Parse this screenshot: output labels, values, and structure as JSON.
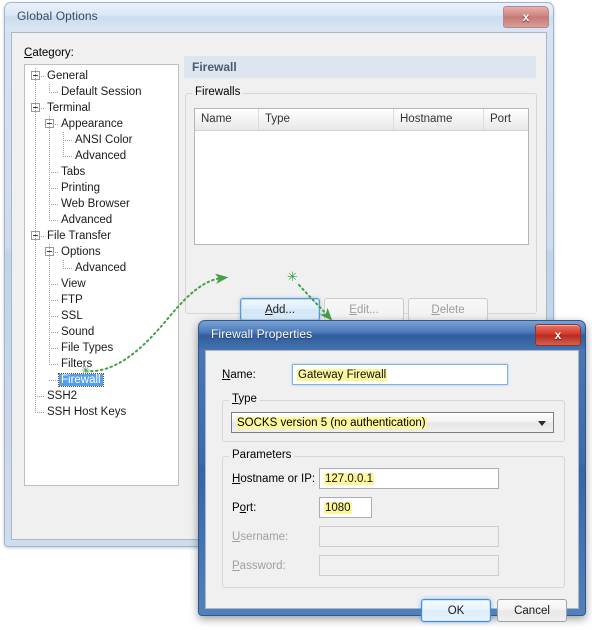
{
  "main_window": {
    "title": "Global Options",
    "close_label": "x",
    "category_label": "Category:",
    "tree": [
      {
        "label": "General",
        "depth": 0,
        "expander": "minus"
      },
      {
        "label": "Default Session",
        "depth": 1,
        "expander": "none"
      },
      {
        "label": "Terminal",
        "depth": 0,
        "expander": "minus"
      },
      {
        "label": "Appearance",
        "depth": 1,
        "expander": "minus"
      },
      {
        "label": "ANSI Color",
        "depth": 2,
        "expander": "none"
      },
      {
        "label": "Advanced",
        "depth": 2,
        "expander": "none"
      },
      {
        "label": "Tabs",
        "depth": 1,
        "expander": "none"
      },
      {
        "label": "Printing",
        "depth": 1,
        "expander": "none"
      },
      {
        "label": "Web Browser",
        "depth": 1,
        "expander": "none"
      },
      {
        "label": "Advanced",
        "depth": 1,
        "expander": "none"
      },
      {
        "label": "File Transfer",
        "depth": 0,
        "expander": "minus"
      },
      {
        "label": "Options",
        "depth": 1,
        "expander": "minus"
      },
      {
        "label": "Advanced",
        "depth": 2,
        "expander": "none"
      },
      {
        "label": "View",
        "depth": 1,
        "expander": "none"
      },
      {
        "label": "FTP",
        "depth": 1,
        "expander": "none"
      },
      {
        "label": "SSL",
        "depth": 1,
        "expander": "none"
      },
      {
        "label": "Sound",
        "depth": 1,
        "expander": "none"
      },
      {
        "label": "File Types",
        "depth": 1,
        "expander": "none"
      },
      {
        "label": "Filters",
        "depth": 1,
        "expander": "none"
      },
      {
        "label": "Firewall",
        "depth": 1,
        "expander": "none",
        "selected": true
      },
      {
        "label": "SSH2",
        "depth": 0,
        "expander": "none"
      },
      {
        "label": "SSH Host Keys",
        "depth": 0,
        "expander": "none"
      }
    ],
    "page_header": "Firewall",
    "firewalls_group": "Firewalls",
    "table": {
      "columns": [
        "Name",
        "Type",
        "Hostname",
        "Port"
      ],
      "rows": []
    },
    "buttons": {
      "add": "Add...",
      "edit": "Edit...",
      "delete": "Delete"
    }
  },
  "dialog": {
    "title": "Firewall Properties",
    "close_label": "x",
    "name_label": "Name:",
    "name_value": "Gateway Firewall",
    "type_group": "Type",
    "type_value": "SOCKS version 5 (no authentication)",
    "parameters_group": "Parameters",
    "hostname_label": "Hostname or IP:",
    "hostname_value": "127.0.0.1",
    "port_label": "Port:",
    "port_value": "1080",
    "username_label": "Username:",
    "username_value": "",
    "password_label": "Password:",
    "password_value": "",
    "ok": "OK",
    "cancel": "Cancel"
  },
  "annotations": {
    "arrow_color": "#43a047",
    "star_glyph": "✳"
  },
  "colors": {
    "highlight_yellow": "#fbf79a",
    "selection_blue": "#55a0e8",
    "header_band": "#dde5ef"
  }
}
